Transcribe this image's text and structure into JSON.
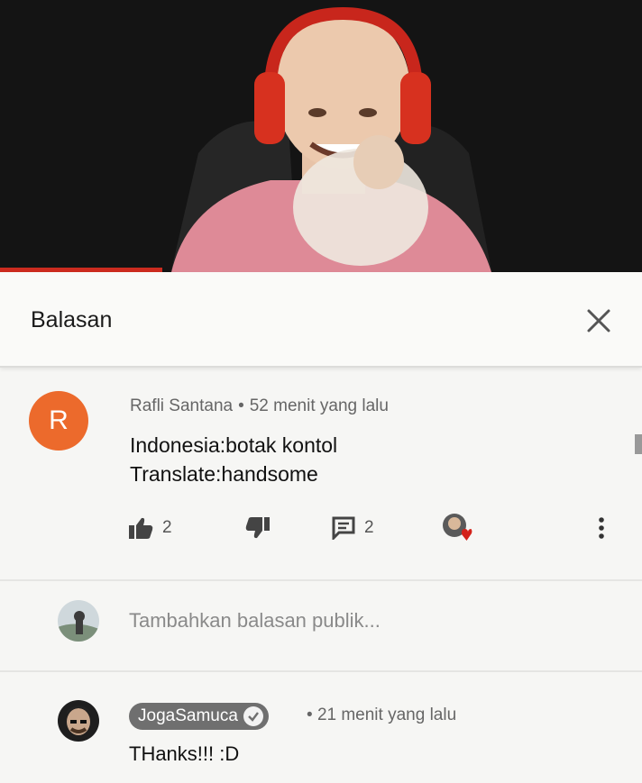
{
  "video": {
    "accent": "#cc2b1f",
    "background": "#121212"
  },
  "panel": {
    "title": "Balasan",
    "close_icon": "close-icon"
  },
  "comment": {
    "avatar_letter": "R",
    "avatar_color": "#ec6a2c",
    "author": "Rafli Santana",
    "separator": "•",
    "time": "52 menit yang lalu",
    "lines": [
      "Indonesia:botak kontol",
      "Translate:handsome"
    ],
    "likes": "2",
    "replies": "2",
    "icons": [
      "thumb-up-icon",
      "thumb-down-icon",
      "reply-icon",
      "creator-heart-icon",
      "more-vert-icon"
    ]
  },
  "reply_input": {
    "placeholder": "Tambahkan balasan publik..."
  },
  "reply": {
    "author": "JogaSamuca",
    "separator": "•",
    "time": "21 menit yang lalu",
    "text": "THanks!!! :D"
  }
}
